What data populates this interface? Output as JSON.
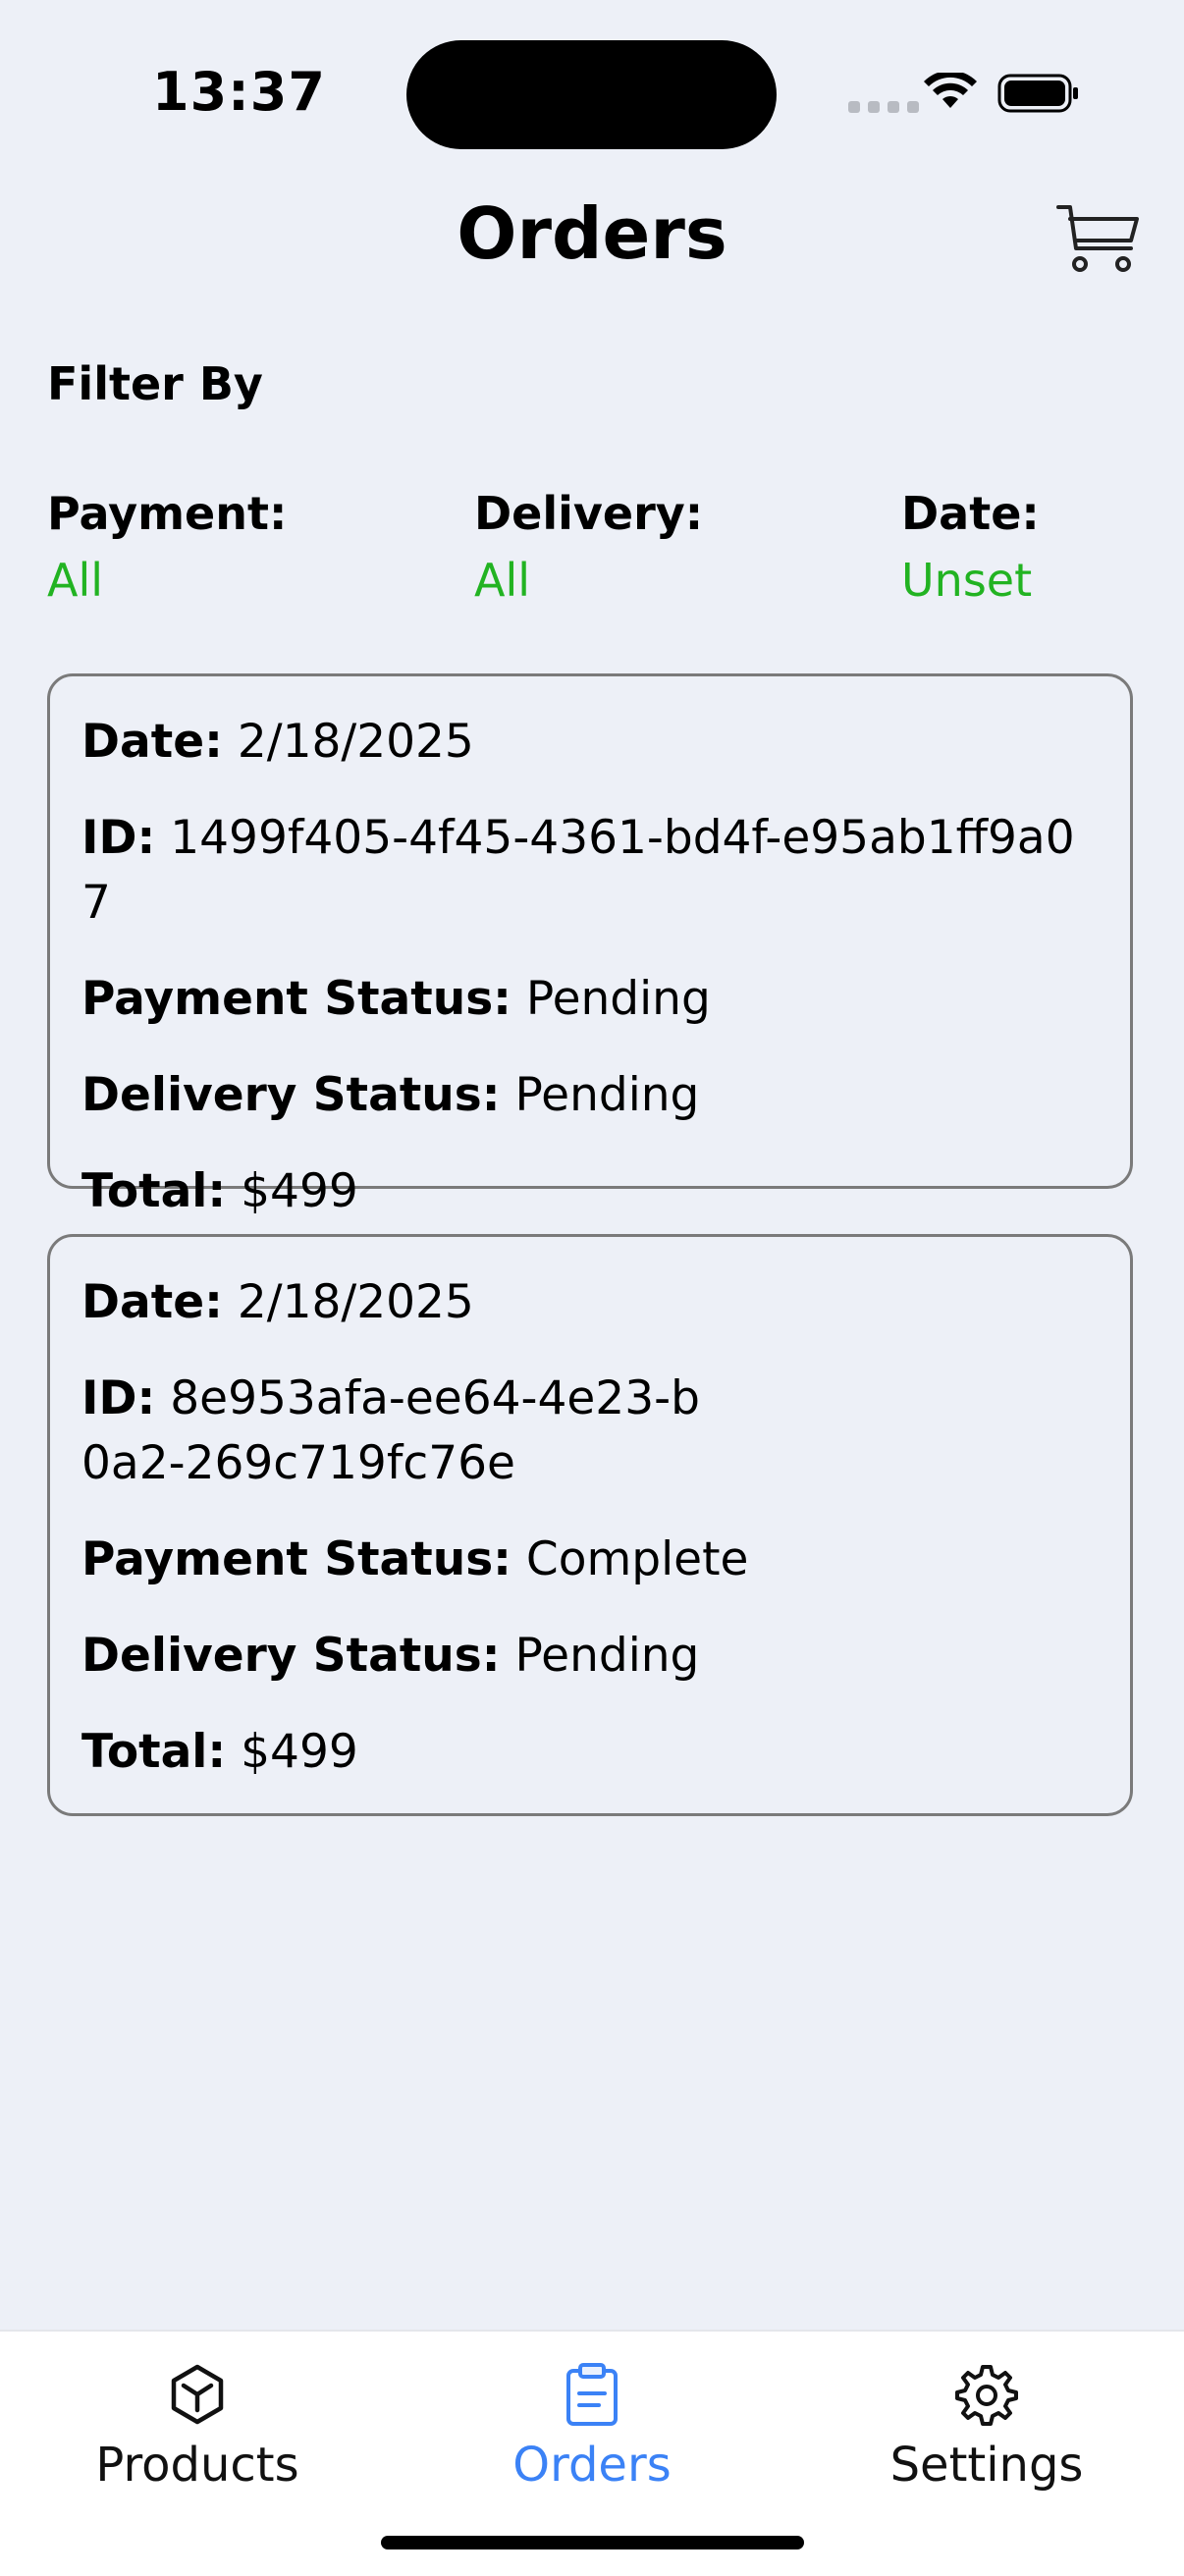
{
  "status_bar": {
    "time": "13:37"
  },
  "header": {
    "title": "Orders",
    "cart_icon": "cart-icon"
  },
  "filters": {
    "heading": "Filter By",
    "payment": {
      "label": "Payment:",
      "value": "All"
    },
    "delivery": {
      "label": "Delivery:",
      "value": "All"
    },
    "date": {
      "label": "Date:",
      "value": "Unset"
    },
    "value_color": "#22B322"
  },
  "orders": [
    {
      "date_label": "Date:",
      "date": "2/18/2025",
      "id_label": "ID:",
      "id": "1499f405-4f45-4361-bd4f-e95ab1ff9a07",
      "payment_status_label": "Payment Status:",
      "payment_status": "Pending",
      "delivery_status_label": "Delivery Status:",
      "delivery_status": "Pending",
      "total_label": "Total:",
      "total": "$499"
    },
    {
      "date_label": "Date:",
      "date": "2/18/2025",
      "id_label": "ID:",
      "id": "8e953afa-ee64-4e23-b0a2-269c719fc76e",
      "payment_status_label": "Payment Status:",
      "payment_status": "Complete",
      "delivery_status_label": "Delivery Status:",
      "delivery_status": "Pending",
      "total_label": "Total:",
      "total": "$499"
    }
  ],
  "tab_bar": {
    "tabs": [
      {
        "label": "Products",
        "icon": "cube-icon",
        "active": false
      },
      {
        "label": "Orders",
        "icon": "clipboard-icon",
        "active": true
      },
      {
        "label": "Settings",
        "icon": "gear-icon",
        "active": false
      }
    ],
    "active_color": "#3B82F6"
  }
}
